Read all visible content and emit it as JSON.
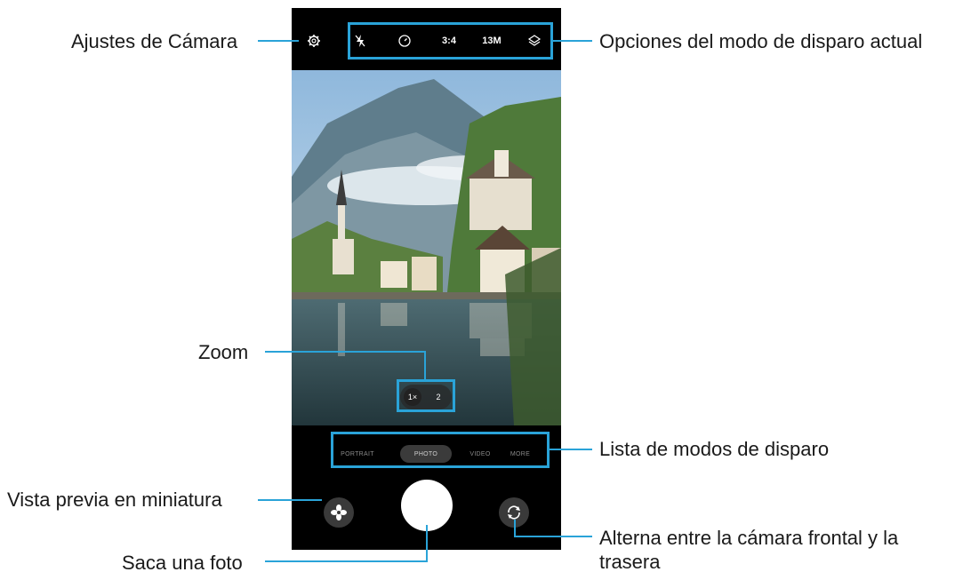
{
  "callouts": {
    "settings": "Ajustes de Cámara",
    "options": "Opciones del modo de disparo actual",
    "zoom": "Zoom",
    "modes": "Lista de modos de disparo",
    "thumbnail": "Vista previa en miniatura",
    "shutter": "Saca una foto",
    "flip_line1": "Alterna entre la cámara frontal y la",
    "flip_line2": "trasera"
  },
  "camera": {
    "top_options": {
      "ratio": "3:4",
      "resolution": "13M"
    },
    "zoom": {
      "level_1": "1×",
      "level_2": "2"
    },
    "modes": [
      "PORTRAIT",
      "PHOTO",
      "VIDEO",
      "MORE"
    ],
    "active_mode": "PHOTO"
  },
  "colors": {
    "accent": "#2aa3d8",
    "phone_bg": "#000000",
    "sky": "#b7d3ea",
    "lake": "#334c55"
  },
  "icons": [
    "settings-gear-icon",
    "flash-off-icon",
    "timer-icon",
    "filters-icon",
    "thumbnail-flower-icon",
    "switch-camera-icon"
  ]
}
